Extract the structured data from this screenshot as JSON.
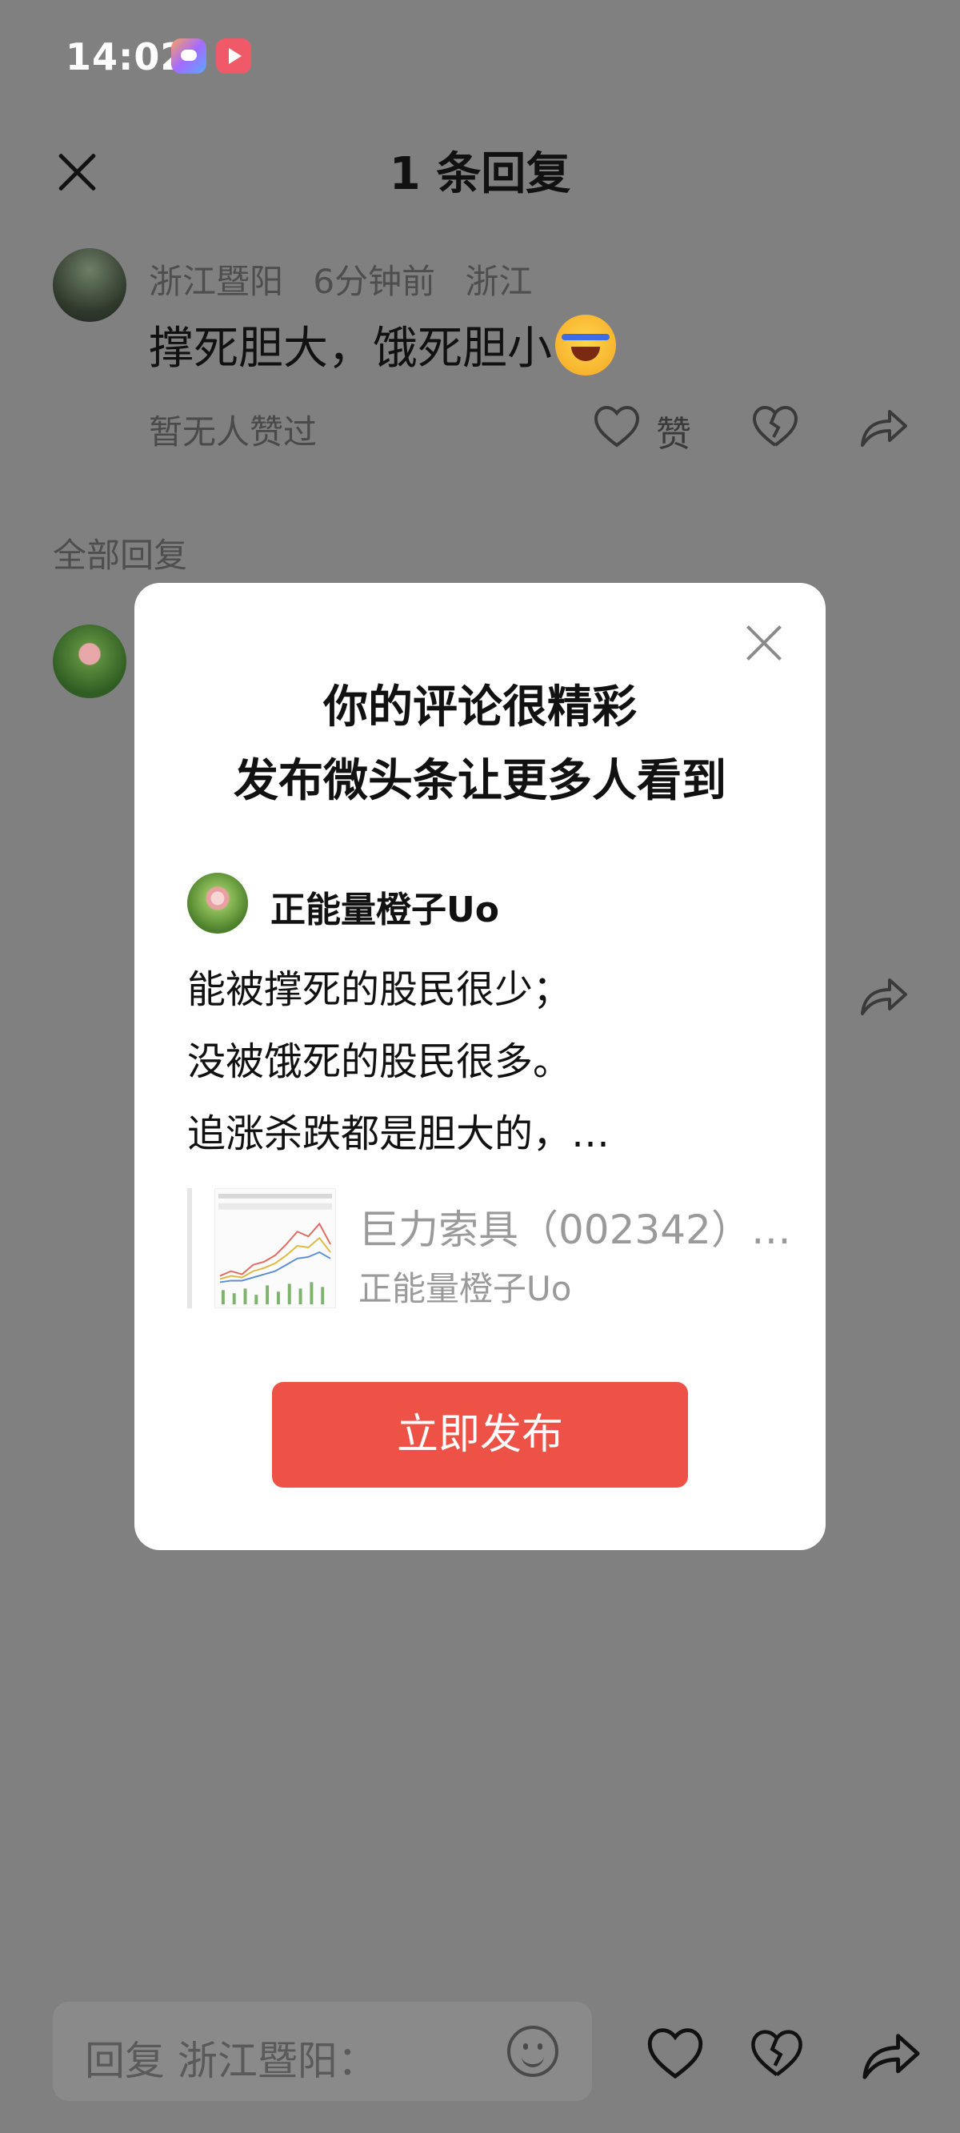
{
  "status_bar": {
    "time": "14:02"
  },
  "header": {
    "title": "1 条回复"
  },
  "comment": {
    "author": "浙江暨阳",
    "time": "6分钟前",
    "location": "浙江",
    "text": "撑死胆大，饿死胆小",
    "no_likes": "暂无人赞过",
    "like_label": "赞"
  },
  "all_replies_label": "全部回复",
  "bottom_bar": {
    "reply_placeholder": "回复 浙江暨阳："
  },
  "modal": {
    "title_line1": "你的评论很精彩",
    "title_line2": "发布微头条让更多人看到",
    "post_author": "正能量橙子Uo",
    "post_lines": [
      "能被撑死的股民很少；",
      "没被饿死的股民很多。",
      "追涨杀跌都是胆大的，…"
    ],
    "quote_title": "巨力索具（002342）…",
    "quote_sub": "正能量橙子Uo",
    "publish_label": "立即发布"
  },
  "icons": {
    "close": "close-icon",
    "like": "heart-icon",
    "dislike": "broken-heart-icon",
    "share": "share-icon",
    "emoji": "smiley-icon"
  },
  "colors": {
    "accent": "#ee5146",
    "overlay": "#808080"
  }
}
